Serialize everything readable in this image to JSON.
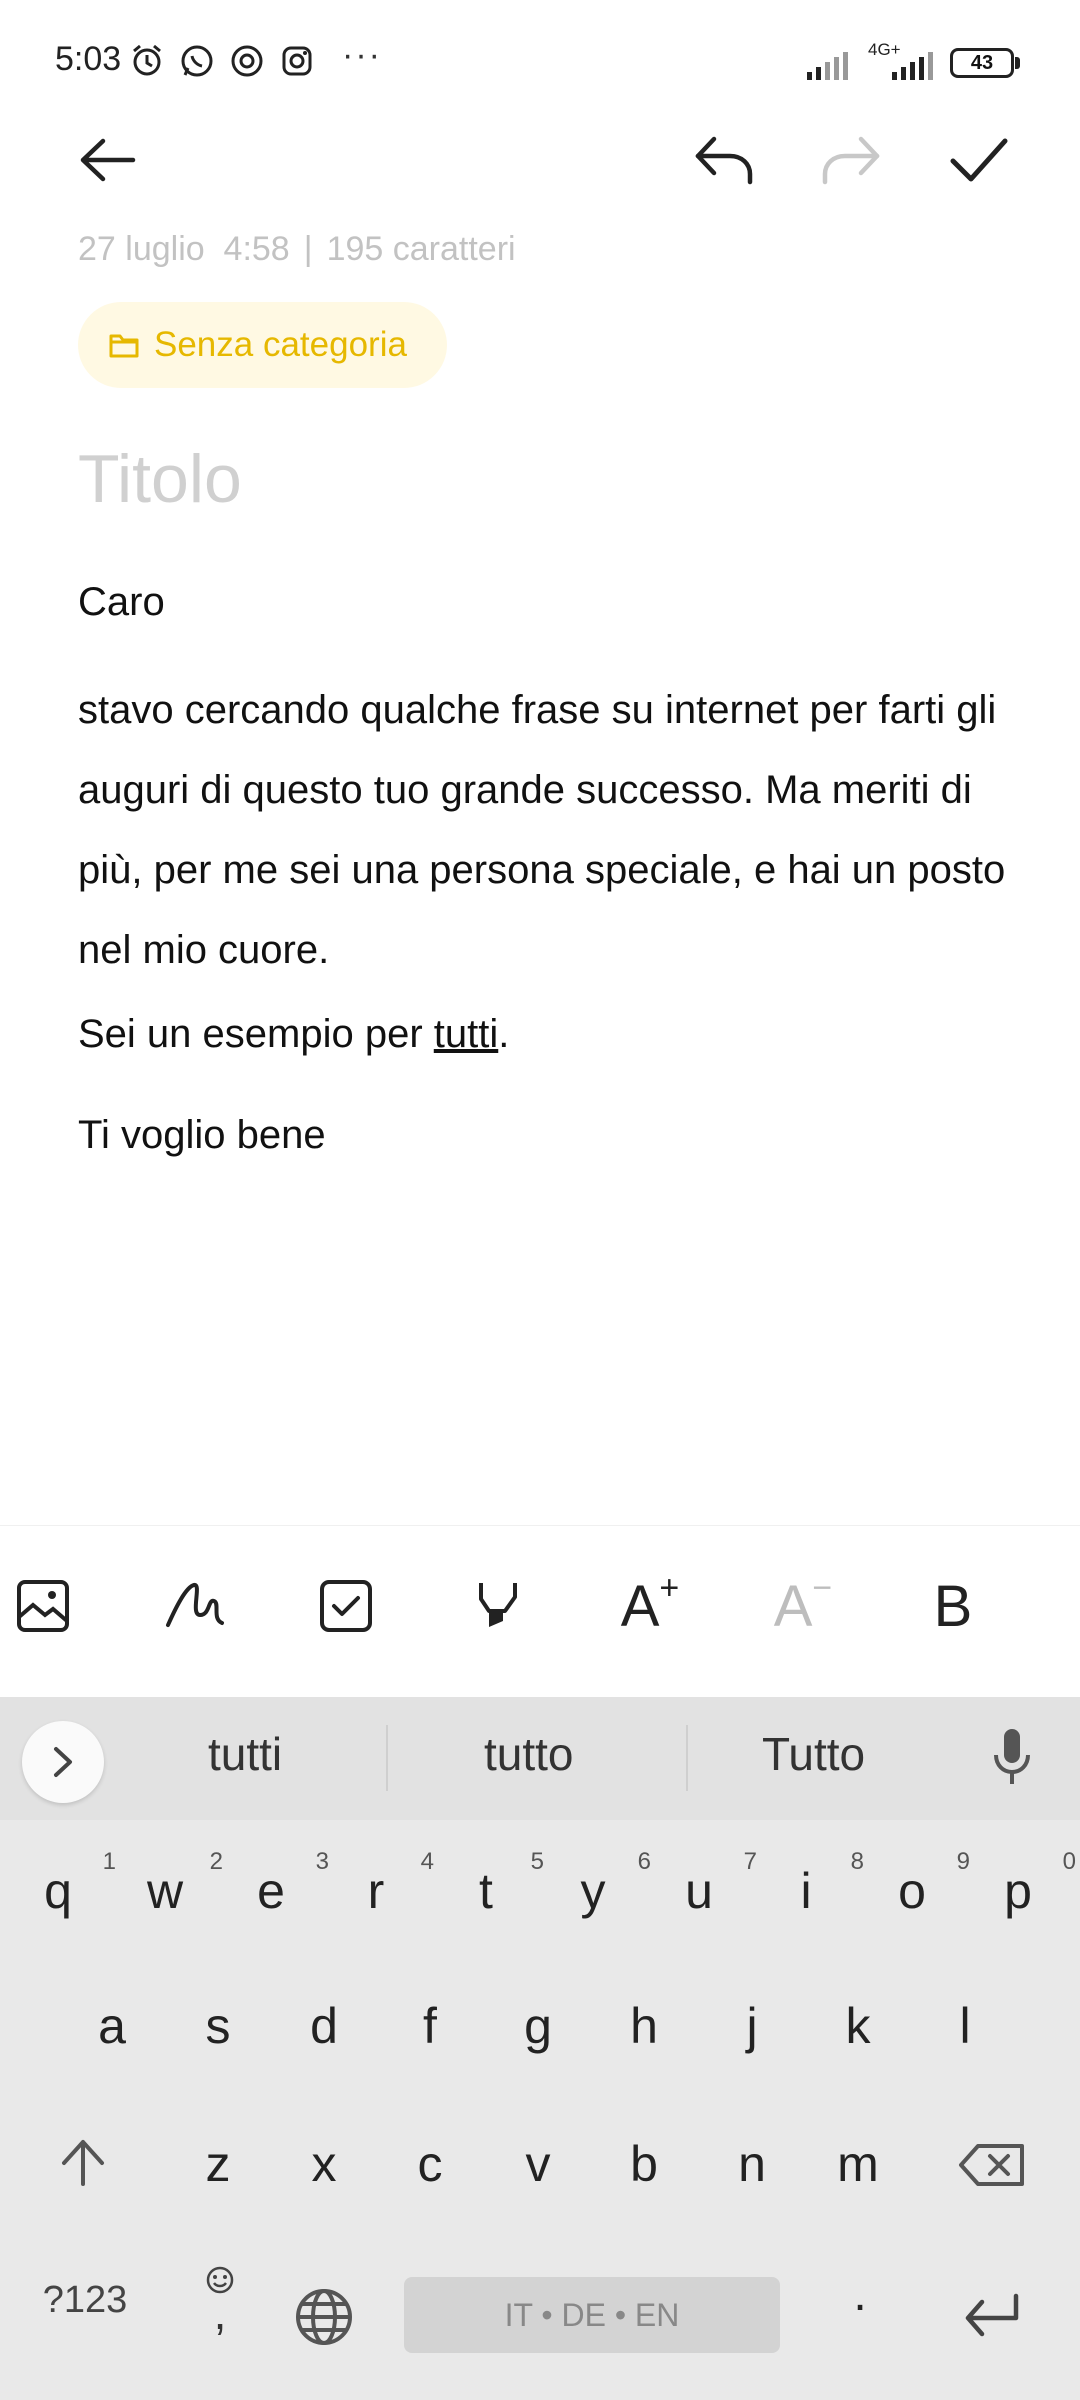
{
  "status_bar": {
    "time": "5:03",
    "network": "4G+",
    "battery": "43",
    "more": "···"
  },
  "toolbar": {
    "back_icon": "arrow-left-icon",
    "undo_icon": "undo-icon",
    "redo_icon": "redo-icon",
    "confirm_icon": "check-icon"
  },
  "note": {
    "date": "27 luglio  4:58",
    "separator": "|",
    "char_count": "195 caratteri",
    "category": "Senza categoria",
    "title_placeholder": "Titolo",
    "greeting": "Caro",
    "paragraph1": "stavo cercando qualche frase su internet per farti gli auguri di questo tuo grande successo. Ma meriti di più, per me sei una persona speciale, e hai un posto nel mio cuore.",
    "paragraph2_prefix": "Sei un esempio per ",
    "paragraph2_word": "tutti",
    "paragraph2_suffix": ".",
    "paragraph3": "Ti voglio bene"
  },
  "format_bar": {
    "items": [
      "image-icon",
      "draw-icon",
      "checklist-icon",
      "highlight-icon",
      "text-increase-icon",
      "text-decrease-icon",
      "bold-icon"
    ],
    "font_plus": "A",
    "font_minus": "A",
    "bold": "B"
  },
  "keyboard": {
    "suggestions": [
      "tutti",
      "tutto",
      "Tutto"
    ],
    "row1": [
      "q",
      "w",
      "e",
      "r",
      "t",
      "y",
      "u",
      "i",
      "o",
      "p"
    ],
    "row1_hints": [
      "1",
      "2",
      "3",
      "4",
      "5",
      "6",
      "7",
      "8",
      "9",
      "0"
    ],
    "row2": [
      "a",
      "s",
      "d",
      "f",
      "g",
      "h",
      "j",
      "k",
      "l"
    ],
    "row3": [
      "z",
      "x",
      "c",
      "v",
      "b",
      "n",
      "m"
    ],
    "symbols_key": "?123",
    "comma_key": ",",
    "space_label": "IT • DE • EN",
    "period_key": "."
  }
}
